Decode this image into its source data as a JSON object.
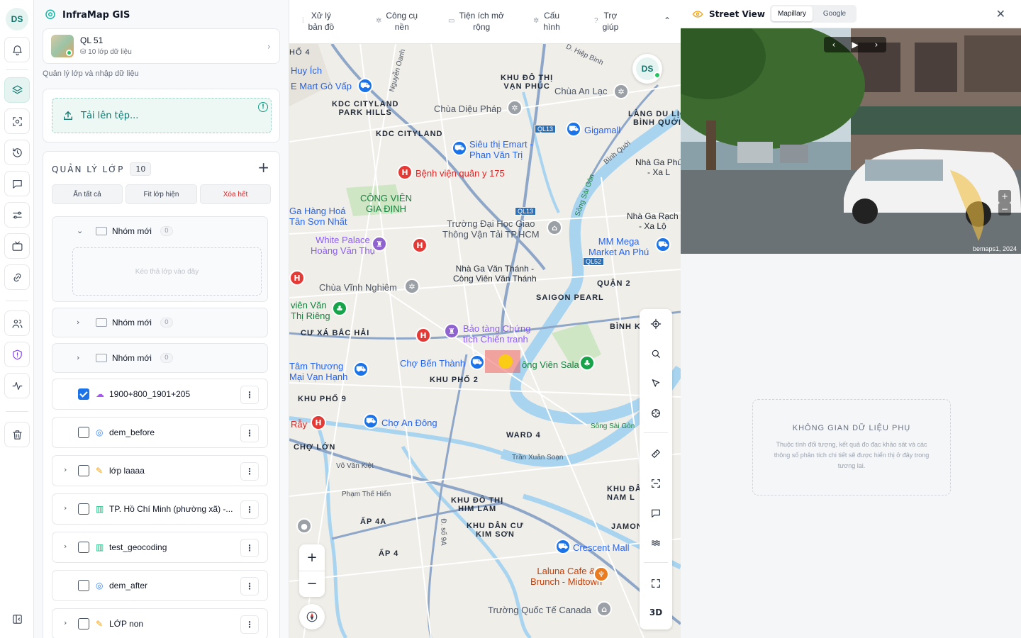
{
  "app": {
    "name": "InfraMap GIS",
    "user_initials": "DS"
  },
  "rail": {
    "items": [
      "notifications",
      "layers",
      "scan",
      "history",
      "chat",
      "settings",
      "tv",
      "link",
      "users",
      "shield",
      "activity",
      "trash",
      "collapse"
    ]
  },
  "project": {
    "name": "QL 51",
    "subtitle": "10 lớp dữ liệu"
  },
  "panel": {
    "hint": "Quản lý lớp và nhập dữ liệu",
    "upload_label": "Tải lên tệp..."
  },
  "layers": {
    "title": "QUẢN LÝ LỚP",
    "count": "10",
    "buttons": {
      "hide_all": "Ẩn tất cả",
      "fit": "Fit lớp hiện",
      "clear": "Xóa hết"
    },
    "groups": [
      {
        "name": "Nhóm mới",
        "count": "0",
        "drop_hint": "Kéo thả lớp vào đây"
      },
      {
        "name": "Nhóm mới",
        "count": "0"
      },
      {
        "name": "Nhóm mới",
        "count": "0"
      }
    ],
    "items": [
      {
        "name": "1900+800_1901+205",
        "checked": true,
        "icon": "cloud-icon"
      },
      {
        "name": "dem_before",
        "checked": false,
        "icon": "globe-icon"
      },
      {
        "name": "lớp laaaa",
        "checked": false,
        "icon": "ruler-icon"
      },
      {
        "name": "TP. Hồ Chí Minh (phường xã) -...",
        "checked": false,
        "icon": "map-icon"
      },
      {
        "name": "test_geocoding",
        "checked": false,
        "icon": "map-icon"
      },
      {
        "name": "dem_after",
        "checked": false,
        "icon": "globe-icon"
      },
      {
        "name": "LỚP non",
        "checked": false,
        "icon": "ruler-icon"
      }
    ]
  },
  "topbar": {
    "menus": [
      "Xử lý\nbản đồ",
      "Công cụ\nnền",
      "Tiện ích mở\nrộng",
      "Cấu\nhình",
      "Trợ\ngiúp"
    ]
  },
  "map": {
    "labels": {
      "huy_ich": "Huy Ích",
      "emart_go_vap": "E Mart Gò Vấp",
      "nguyen_oanh": "Nguyễn Oanh",
      "kdt_van_phuc": "KHU ĐÔ THỊ\nVẠN PHÚC",
      "chua_an_lac": "Chùa An Lạc",
      "hiep_binh": "D. Hiệp Bình",
      "kdc_park_hills": "KDC CITYLAND\nPARK HILLS",
      "chua_dieu_phap": "Chùa Diệu Pháp",
      "lang_du_lich": "LÀNG DU LỊC\nBÌNH QUỚI",
      "kdc_cityland": "KDC CITYLAND",
      "gigamall": "Gigamall",
      "emart_pvt": "Siêu thị Emart -\nPhan Văn Trị",
      "binh_quoi": "Bình Quới",
      "nha_ga_phu": "Nhà Ga Phú\n- Xa L",
      "bv_175": "Bệnh viện quân y 175",
      "cong_vien_gd": "CÔNG VIÊN\nGIA ĐỊNH",
      "song_sai_gon": "Sông Sài Gòn",
      "ga_hang_hoa": "Ga Hàng Hoá\nTân Sơn Nhất",
      "dh_gtvt": "Trường Đại Học Giao\nThông Vận Tải TP.HCM",
      "nha_ga_rach": "Nhà Ga Rạch\n- Xa Lộ",
      "white_palace": "White Palace\nHoàng Văn Thụ",
      "mm_mega": "MM Mega\nMarket An Phú",
      "nha_ga_vt": "Nhà Ga Văn Thánh -\nCông Viên Văn Thánh",
      "quan2": "QUẬN 2",
      "chua_vinh_nghiem": "Chùa Vĩnh Nghiêm",
      "saigon_pearl": "SAIGON PEARL",
      "vien_van": "viên Văn\nThị Riêng",
      "cu_xa": "CƯ XÁ BẮC HẢI",
      "bao_tang": "Bảo tàng Chứng\ntích Chiến tranh",
      "binh_k": "BÌNH K",
      "tam_thuong": "Tâm Thương\nMại Vạn Hạnh",
      "cho_ben_thanh": "Chợ Bến Thành",
      "cong_vien_sala": "ông Viên Sala",
      "khu_pho_2": "KHU PHỐ 2",
      "khu_pho_9": "KHU PHỐ 9",
      "ray": "Rẫy",
      "cho_an_dong": "Chợ An Đông",
      "song_sg2": "Sông Sài Gòn",
      "cho_lon": "CHỢ LỚN",
      "ward4": "WARD 4",
      "tran_xuan_soan": "Trần Xuân Soạn",
      "vo_van_kiet": "Võ Văn Kiệt",
      "pham_the_hien": "Phạm Thế Hiển",
      "khu_da": "KHU ĐÂ\nNAM L",
      "kdt_him_lam": "KHU ĐÔ THỊ\nHIM LAM",
      "ap_4a": "ẤP 4A",
      "kdc_kim_son": "KHU DÂN CƯ\nKIM SƠN",
      "jamon": "JAMON",
      "crescent": "Crescent Mall",
      "ap_4": "ẤP 4",
      "laluna": "Laluna Cafe &\nBrunch - Midtown",
      "canada": "Trường Quốc Tế Canada",
      "ho4": "HỐ 4",
      "so9a": "Đ. số 9A"
    },
    "shields": [
      "QL13",
      "QL13",
      "QL52"
    ],
    "tools": [
      "locate",
      "search",
      "select",
      "target",
      "measure",
      "scan",
      "comment",
      "layers",
      "fullscreen",
      "3D"
    ],
    "three_d": "3D"
  },
  "streetview": {
    "title": "Street View",
    "tabs": [
      "Mapillary",
      "Google"
    ],
    "active_tab": "Mapillary",
    "attribution": "bemaps1, 2024",
    "placeholder_title": "KHÔNG GIAN DỮ LIỆU PHỤ",
    "placeholder_desc": "Thuộc tính đối tượng, kết quả đo đạc khảo sát và các thông số phân tích chi tiết sẽ được hiển thị ở đây trong tương lai."
  },
  "colors": {
    "accent": "#0f766e",
    "map_water": "#a8d4f0",
    "map_road": "#ffffff",
    "map_highway": "#f4c25a"
  }
}
